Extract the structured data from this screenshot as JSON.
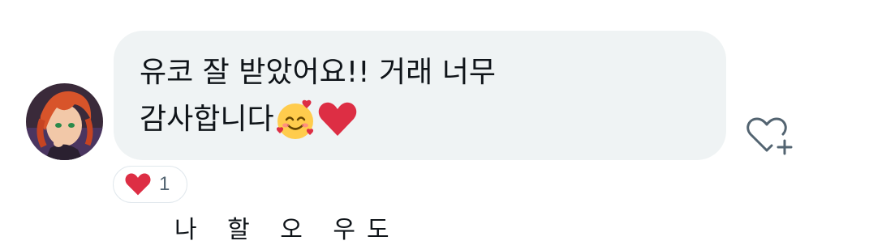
{
  "message": {
    "line1": "유코 잘 받았어요!! 거래 너무",
    "line2": "감사합니다",
    "emoji_1": "smiling-face-with-hearts",
    "emoji_2": "red-heart"
  },
  "reaction": {
    "emoji": "red-heart",
    "count": "1"
  },
  "next_message_partial": "나 할 오 우도",
  "colors": {
    "bubble": "#eff3f4",
    "text": "#0f1419",
    "secondary": "#536471",
    "heart": "#e0245e"
  }
}
